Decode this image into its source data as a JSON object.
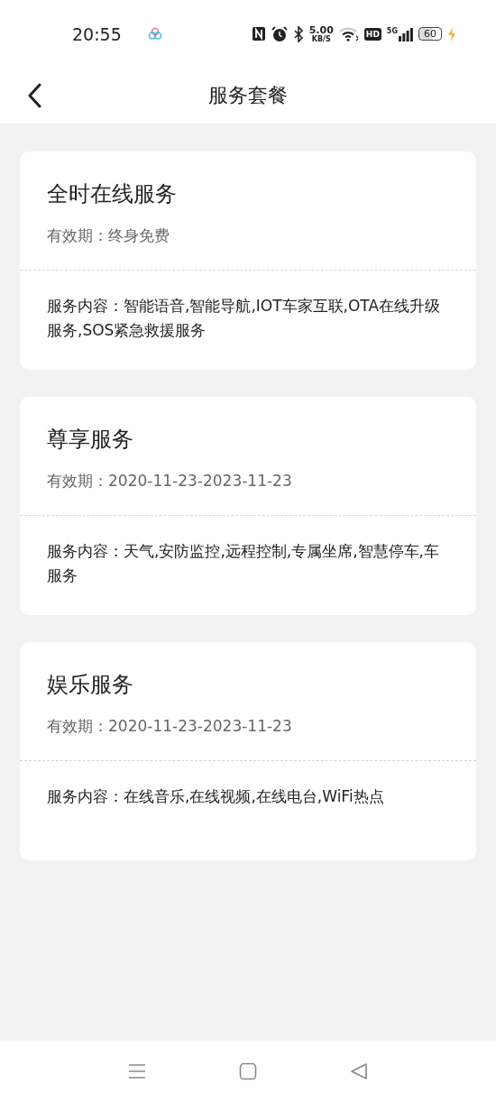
{
  "status_bar": {
    "time": "20:55",
    "speed_value": "5.00",
    "speed_unit": "KB/S",
    "hd": "HD",
    "network": "5G",
    "battery": "60"
  },
  "header": {
    "title": "服务套餐"
  },
  "packages": [
    {
      "name": "全时在线服务",
      "validity": "有效期：终身免费",
      "content": "服务内容：智能语音,智能导航,IOT车家互联,OTA在线升级服务,SOS紧急救援服务"
    },
    {
      "name": "尊享服务",
      "validity": "有效期：2020-11-23-2023-11-23",
      "content": "服务内容：天气,安防监控,远程控制,专属坐席,智慧停车,车服务"
    },
    {
      "name": "娱乐服务",
      "validity": "有效期：2020-11-23-2023-11-23",
      "content": "服务内容：在线音乐,在线视频,在线电台,WiFi热点"
    }
  ]
}
